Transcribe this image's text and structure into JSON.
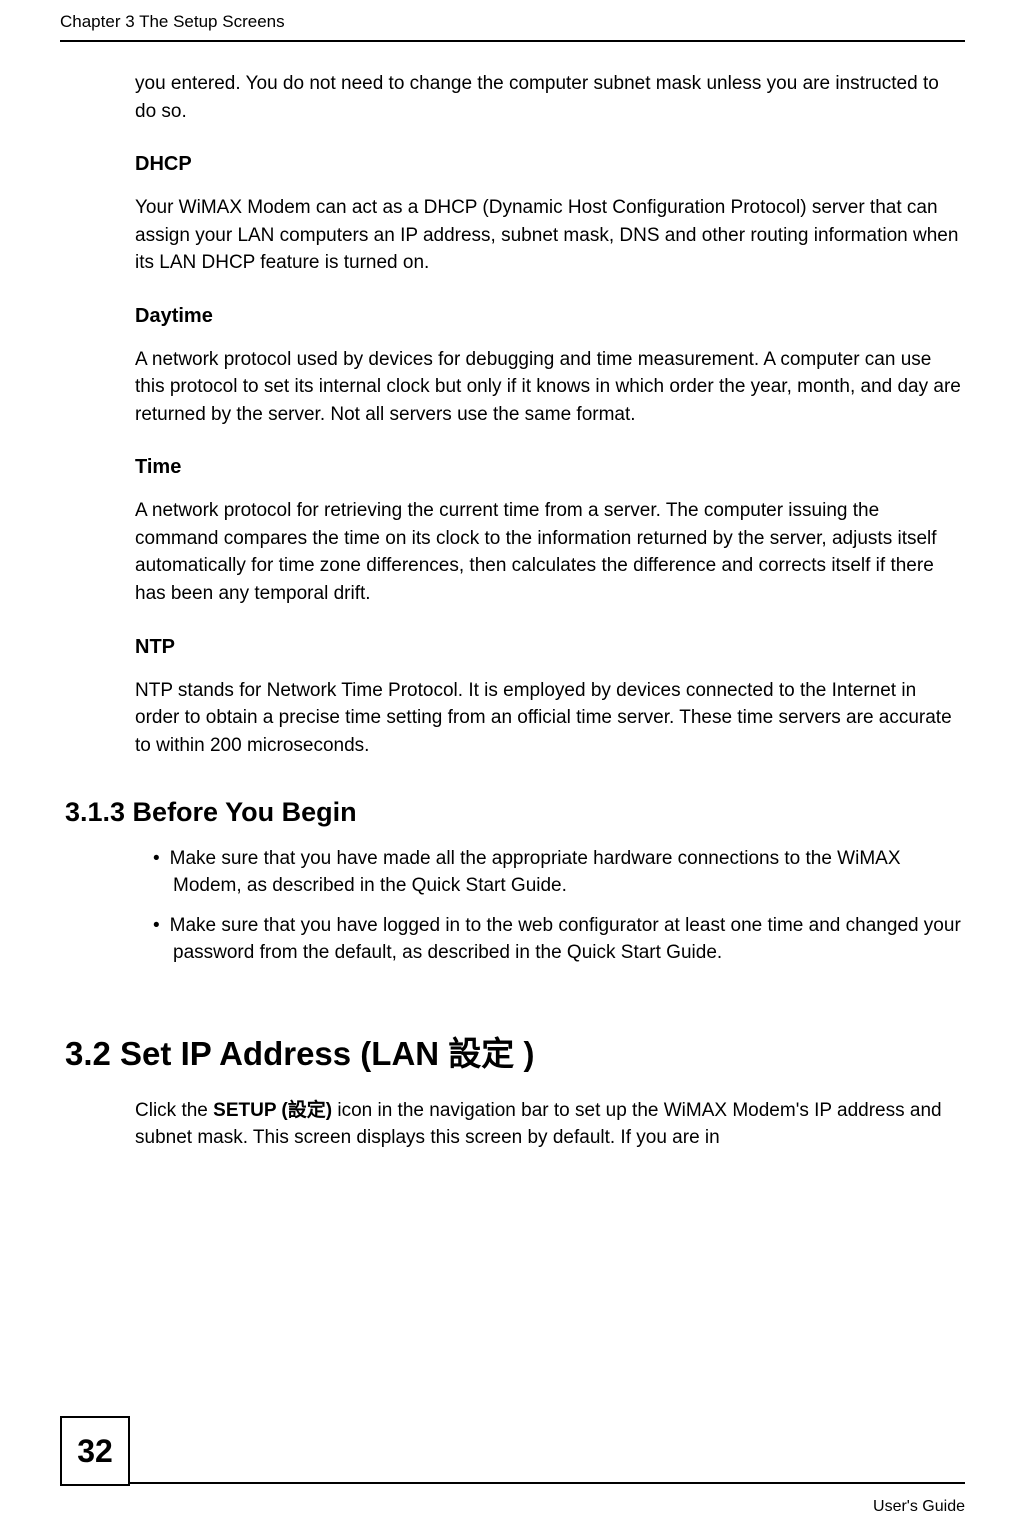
{
  "header": {
    "chapter": "Chapter 3 The Setup Screens"
  },
  "intro_p": "you entered. You do not need to change the computer subnet mask unless you are instructed to do so.",
  "dhcp": {
    "title": "DHCP",
    "text": "Your WiMAX Modem can act as a DHCP (Dynamic Host Configuration Protocol) server that can assign your LAN computers an IP address, subnet mask, DNS and other routing information when its LAN DHCP feature is turned on."
  },
  "daytime": {
    "title": "Daytime",
    "text": "A network protocol used by devices for debugging and time measurement. A computer can use this protocol to set its internal clock but only if it knows in which order the year, month, and day are returned by the server. Not all servers use the same format."
  },
  "time": {
    "title": "Time",
    "text": "A network protocol for retrieving the current time from a server. The computer issuing the command compares the time on its clock to the information returned by the server, adjusts itself automatically for time zone differences, then calculates the difference and corrects itself if there has been any temporal drift."
  },
  "ntp": {
    "title": "NTP",
    "text": "NTP stands for Network Time Protocol. It is employed by devices connected to the Internet in order to obtain a precise time setting from an official time server. These time servers are accurate to within 200 microseconds."
  },
  "sec313": {
    "title": "3.1.3  Before You Begin",
    "bullets": [
      "Make sure that you have made all the appropriate hardware connections to the WiMAX Modem, as described in the Quick Start Guide.",
      "Make sure that you have logged in to the web configurator at least one time and changed your password from the default, as described in the Quick Start Guide."
    ]
  },
  "sec32": {
    "title": "3.2  Set IP Address (LAN 設定 )",
    "p_prefix": "Click the ",
    "p_strong": "SETUP  (設定)",
    "p_suffix": " icon in the navigation bar to set up the WiMAX Modem's IP address and subnet mask. This screen displays this screen by default. If you are in"
  },
  "footer": {
    "page": "32",
    "guide": "User's Guide"
  }
}
